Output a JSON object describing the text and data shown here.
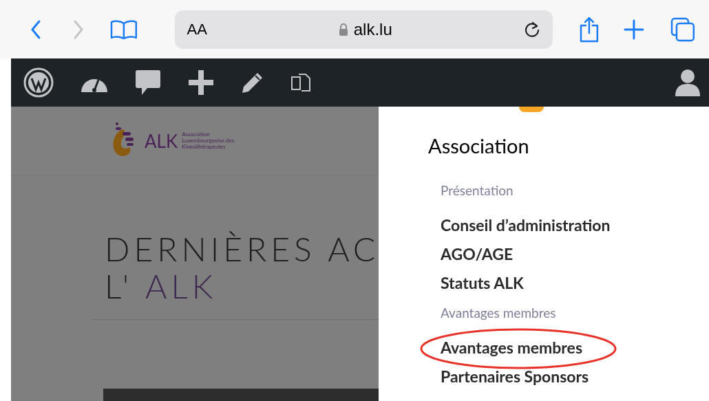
{
  "browser_bar": {
    "text_size_button": "AA",
    "url": "alk.lu"
  },
  "page": {
    "logo": {
      "name": "ALK",
      "subtitle": "Association Luxembourgeoise des Kinesithérapeutes"
    },
    "heading": {
      "line_1": "DERNIÈRES AC",
      "line_2_prefix": "L'",
      "line_2_accent": "ALK"
    }
  },
  "menu": {
    "title": "Association",
    "items": [
      {
        "kind": "section",
        "label": "Présentation",
        "circled": false
      },
      {
        "kind": "link",
        "label": "Conseil d’administration",
        "circled": false
      },
      {
        "kind": "link",
        "label": "AGO/AGE",
        "circled": false
      },
      {
        "kind": "link",
        "label": "Statuts ALK",
        "circled": false
      },
      {
        "kind": "section",
        "label": "Avantages membres",
        "circled": false
      },
      {
        "kind": "link",
        "label": "Avantages membres",
        "circled": true
      },
      {
        "kind": "link",
        "label": "Partenaires Sponsors",
        "circled": false
      }
    ]
  }
}
